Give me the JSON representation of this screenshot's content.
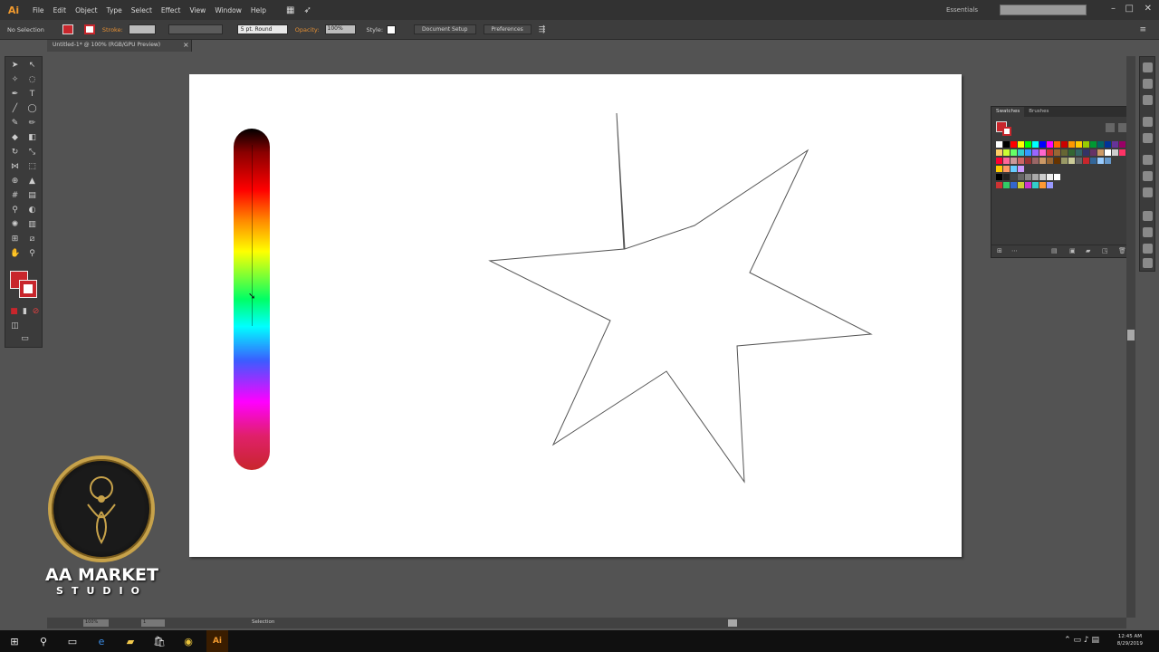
{
  "app": {
    "logo": "Ai"
  },
  "menu": [
    "File",
    "Edit",
    "Object",
    "Type",
    "Select",
    "Effect",
    "View",
    "Window",
    "Help"
  ],
  "workspace": "Essentials",
  "control_bar": {
    "selection": "No Selection",
    "stroke_label": "Stroke:",
    "brush": "5 pt. Round",
    "opacity_label": "Opacity:",
    "opacity": "100%",
    "style_label": "Style:",
    "document_setup": "Document Setup",
    "preferences": "Preferences"
  },
  "document": {
    "tab_title": "Untitled-1* @ 100% (RGB/GPU Preview)",
    "tab_close": "×"
  },
  "colors": {
    "fill": "#c8262c",
    "stroke": "#c8262c",
    "accent": "#e48f34"
  },
  "swatches": {
    "tabs": [
      "Swatches",
      "Brushes"
    ],
    "rows": [
      [
        "#ffffff",
        "#000000",
        "#ff0000",
        "#ffff00",
        "#00ff00",
        "#00ffff",
        "#0000ff",
        "#ff00ff",
        "#ff6600",
        "#cc0000",
        "#ff9900",
        "#ffcc00",
        "#99cc00",
        "#009933",
        "#006666",
        "#003399",
        "#663399",
        "#990066"
      ],
      [
        "#ffcc66",
        "#ccff33",
        "#66ff66",
        "#33cccc",
        "#3399ff",
        "#9966ff",
        "#ff66cc",
        "#cc3333",
        "#996633",
        "#666633",
        "#336633",
        "#336666",
        "#333366",
        "#663366",
        "#cc9966",
        "#ffffff",
        "#cccccc",
        "#ff3366"
      ],
      [
        "#ff0033",
        "#ff6699",
        "#cc9999",
        "#cc6666",
        "#993333",
        "#996666",
        "#cc9966",
        "#996633",
        "#663300",
        "#999966",
        "#cccc99",
        "#666666",
        "#c8262c",
        "#336699",
        "#99ccff",
        "#6699cc"
      ],
      [
        "#ffcc00",
        "#ff9966",
        "#66ccff",
        "#cc99ff"
      ],
      [
        "#000000",
        "#222222",
        "#444444",
        "#666666",
        "#888888",
        "#aaaaaa",
        "#cccccc",
        "#eeeeee",
        "#ffffff"
      ],
      [
        "#cc3333",
        "#33cc66",
        "#3366cc",
        "#cccc33",
        "#cc33cc",
        "#33cccc",
        "#ff9933",
        "#9999ff"
      ]
    ]
  },
  "status": {
    "zoom": "100%",
    "artboard": "1",
    "tool": "Selection"
  },
  "taskbar": {
    "time": "12:45 AM",
    "date": "8/29/2019"
  },
  "brand": {
    "name": "AA MARKET",
    "sub": "STUDIO"
  }
}
